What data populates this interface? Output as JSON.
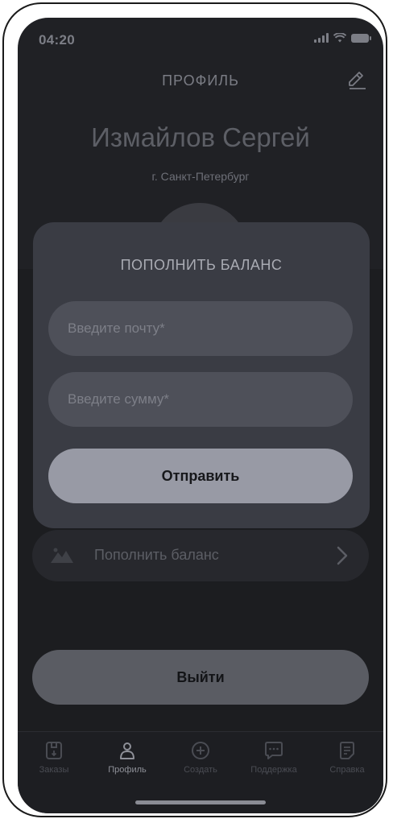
{
  "status_bar": {
    "time": "04:20"
  },
  "header": {
    "title": "ПРОФИЛЬ",
    "edit_icon": "edit-icon"
  },
  "profile": {
    "name": "Измайлов Сергей",
    "city": "г. Санкт-Петербург"
  },
  "menu": {
    "items": [
      {
        "label": "Пополнить баланс",
        "icon": "mountain-icon"
      }
    ]
  },
  "logout": {
    "label": "Выйти"
  },
  "modal": {
    "title": "ПОПОЛНИТЬ БАЛАНС",
    "email_placeholder": "Введите почту*",
    "amount_placeholder": "Введите сумму*",
    "submit_label": "Отправить"
  },
  "tabs": [
    {
      "label": "Заказы",
      "icon": "orders-icon",
      "active": false
    },
    {
      "label": "Профиль",
      "icon": "profile-icon",
      "active": true
    },
    {
      "label": "Создать",
      "icon": "create-icon",
      "active": false
    },
    {
      "label": "Поддержка",
      "icon": "support-icon",
      "active": false
    },
    {
      "label": "Справка",
      "icon": "help-icon",
      "active": false
    }
  ],
  "colors": {
    "background": "#202125",
    "modal": "#3a3c44",
    "accent_button": "#989aa5"
  }
}
